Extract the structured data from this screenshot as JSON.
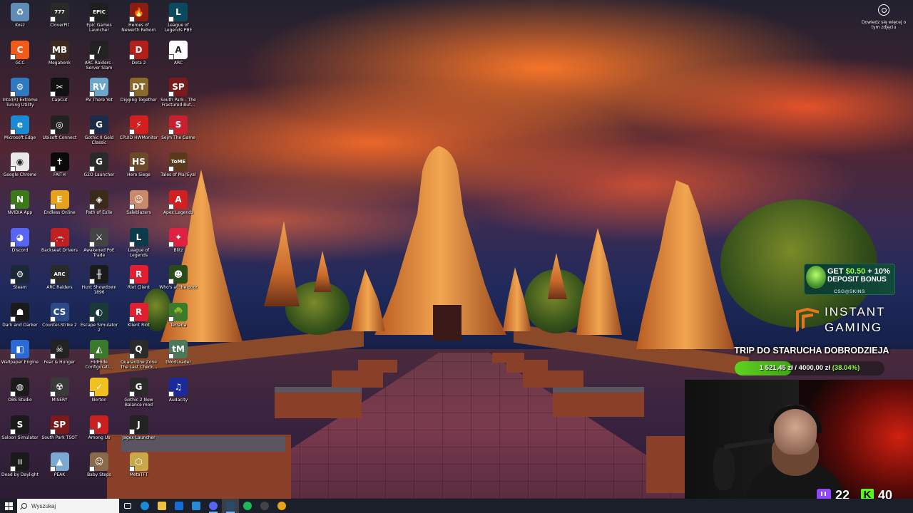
{
  "desktop": {
    "icons": [
      {
        "label": "Kosz",
        "icon": "recycle-bin-icon",
        "color": "#5f8db5",
        "glyph": "♻"
      },
      {
        "label": "CloverPit",
        "icon": "cloverpit-icon",
        "color": "#2a2a2a",
        "glyph": "777"
      },
      {
        "label": "Epic Games Launcher",
        "icon": "epic-games-icon",
        "color": "#1f1f1f",
        "glyph": "EPIC"
      },
      {
        "label": "Heroes of Newerth Reborn",
        "icon": "hon-icon",
        "color": "#8a1d12",
        "glyph": "🔥"
      },
      {
        "label": "League of Legends PBE",
        "icon": "lol-pbe-icon",
        "color": "#0b4a5c",
        "glyph": "L"
      },
      {
        "label": "GCC",
        "icon": "gcc-icon",
        "color": "#f05a1a",
        "glyph": "C"
      },
      {
        "label": "Megabonk",
        "icon": "megabonk-icon",
        "color": "#3d2b20",
        "glyph": "MB"
      },
      {
        "label": "ARC Raiders - Server Slam",
        "icon": "arc-raiders-icon",
        "color": "#222",
        "glyph": "/"
      },
      {
        "label": "Dota 2",
        "icon": "dota2-icon",
        "color": "#b3201a",
        "glyph": "D"
      },
      {
        "label": "ARC",
        "icon": "arc-icon",
        "color": "#ffffff",
        "glyph": "A"
      },
      {
        "label": "Intel(R) Extreme Tuning Utility",
        "icon": "intel-xtu-icon",
        "color": "#2f78c2",
        "glyph": "⚙"
      },
      {
        "label": "CapCut",
        "icon": "capcut-icon",
        "color": "#111",
        "glyph": "✂"
      },
      {
        "label": "RV There Yet",
        "icon": "rv-there-yet-icon",
        "color": "#6ca6c9",
        "glyph": "RV"
      },
      {
        "label": "Digging Together",
        "icon": "digging-together-icon",
        "color": "#8a6a2a",
        "glyph": "DT"
      },
      {
        "label": "South Park - The Fractured But...",
        "icon": "south-park-icon",
        "color": "#7a1a1a",
        "glyph": "SP"
      },
      {
        "label": "Microsoft Edge",
        "icon": "edge-icon",
        "color": "#1a8ad4",
        "glyph": "e"
      },
      {
        "label": "Ubisoft Connect",
        "icon": "ubisoft-icon",
        "color": "#222",
        "glyph": "◎"
      },
      {
        "label": "Gothic II Gold Classic",
        "icon": "gothic2-icon",
        "color": "#1c2b47",
        "glyph": "G"
      },
      {
        "label": "CPUID HWMonitor",
        "icon": "hwmonitor-icon",
        "color": "#d21f1f",
        "glyph": "⚡"
      },
      {
        "label": "Sejm The Game",
        "icon": "sejm-icon",
        "color": "#c82030",
        "glyph": "S"
      },
      {
        "label": "Google Chrome",
        "icon": "chrome-icon",
        "color": "#e8e8e8",
        "glyph": "◉"
      },
      {
        "label": "FAITH",
        "icon": "faith-icon",
        "color": "#0a0a0a",
        "glyph": "✝"
      },
      {
        "label": "G2O Launcher",
        "icon": "g2o-icon",
        "color": "#2a2a2a",
        "glyph": "G"
      },
      {
        "label": "Hero Siege",
        "icon": "hero-siege-icon",
        "color": "#6a4a2a",
        "glyph": "HS"
      },
      {
        "label": "Tales of Maj'Eyal",
        "icon": "tome-icon",
        "color": "#5a3a1a",
        "glyph": "ToME"
      },
      {
        "label": "NVIDIA App",
        "icon": "nvidia-icon",
        "color": "#3a7a1a",
        "glyph": "N"
      },
      {
        "label": "Endless Online",
        "icon": "endless-online-icon",
        "color": "#e8a21a",
        "glyph": "E"
      },
      {
        "label": "Path of Exile",
        "icon": "poe-icon",
        "color": "#3a2a1a",
        "glyph": "◈"
      },
      {
        "label": "Saleblazers",
        "icon": "saleblazers-icon",
        "color": "#c88a6a",
        "glyph": "☺"
      },
      {
        "label": "Apex Legends",
        "icon": "apex-icon",
        "color": "#d21f1f",
        "glyph": "A"
      },
      {
        "label": "Discord",
        "icon": "discord-icon",
        "color": "#5865f2",
        "glyph": "◕"
      },
      {
        "label": "Backseat Drivers",
        "icon": "backseat-drivers-icon",
        "color": "#c02020",
        "glyph": "🚗"
      },
      {
        "label": "Awakened PoE Trade",
        "icon": "awakened-poe-icon",
        "color": "#444",
        "glyph": "⚔"
      },
      {
        "label": "League of Legends",
        "icon": "lol-icon",
        "color": "#0b3a4a",
        "glyph": "L"
      },
      {
        "label": "Blitz",
        "icon": "blitz-icon",
        "color": "#e02040",
        "glyph": "✦"
      },
      {
        "label": "Steam",
        "icon": "steam-icon",
        "color": "#1b2838",
        "glyph": "⚙"
      },
      {
        "label": "ARC Raiders",
        "icon": "arc-raiders-2-icon",
        "color": "#2a2a2a",
        "glyph": "ARC"
      },
      {
        "label": "Hunt Showdown 1896",
        "icon": "hunt-showdown-icon",
        "color": "#1a1a1a",
        "glyph": "╫"
      },
      {
        "label": "Riot Client",
        "icon": "riot-client-icon",
        "color": "#e02030",
        "glyph": "R"
      },
      {
        "label": "Who's at the door",
        "icon": "whos-at-the-door-icon",
        "color": "#2a4a1a",
        "glyph": "☻"
      },
      {
        "label": "Dark and Darker",
        "icon": "dark-and-darker-icon",
        "color": "#1a1a1a",
        "glyph": "☗"
      },
      {
        "label": "Counter-Strike 2",
        "icon": "cs2-icon",
        "color": "#2a4a8a",
        "glyph": "CS"
      },
      {
        "label": "Escape Simulator 2",
        "icon": "escape-sim-icon",
        "color": "#1a3a3a",
        "glyph": "◐"
      },
      {
        "label": "Klient Riot",
        "icon": "klient-riot-icon",
        "color": "#e02030",
        "glyph": "R"
      },
      {
        "label": "Terraria",
        "icon": "terraria-icon",
        "color": "#3a7a2a",
        "glyph": "🌳"
      },
      {
        "label": "Wallpaper Engine",
        "icon": "wallpaper-engine-icon",
        "color": "#2a6ad4",
        "glyph": "◧"
      },
      {
        "label": "Fear & Hunger",
        "icon": "fear-hunger-icon",
        "color": "#222",
        "glyph": "☠"
      },
      {
        "label": "HidHide Configurati...",
        "icon": "hidhide-icon",
        "color": "#3a7a2a",
        "glyph": "◭"
      },
      {
        "label": "Quarantine Zone The Last Check...",
        "icon": "quarantine-zone-icon",
        "color": "#2a2a2a",
        "glyph": "Q"
      },
      {
        "label": "tModLoader",
        "icon": "tmodloader-icon",
        "color": "#4a7a5a",
        "glyph": "tM"
      },
      {
        "label": "OBS Studio",
        "icon": "obs-icon",
        "color": "#1a1a1a",
        "glyph": "◍"
      },
      {
        "label": "MISERY",
        "icon": "misery-icon",
        "color": "#3a3a3a",
        "glyph": "☢"
      },
      {
        "label": "Norton",
        "icon": "norton-icon",
        "color": "#f0c020",
        "glyph": "✓"
      },
      {
        "label": "Gothic 2 New Balance mod",
        "icon": "gothic2-nb-icon",
        "color": "#2a2a2a",
        "glyph": "G"
      },
      {
        "label": "Audacity",
        "icon": "audacity-icon",
        "color": "#1a2a9a",
        "glyph": "♫"
      },
      {
        "label": "Saloon Simulator",
        "icon": "saloon-sim-icon",
        "color": "#1a1a1a",
        "glyph": "S"
      },
      {
        "label": "South Park TSOT",
        "icon": "south-park-tsot-icon",
        "color": "#7a1a1a",
        "glyph": "SP"
      },
      {
        "label": "Among Us",
        "icon": "among-us-icon",
        "color": "#c81f1f",
        "glyph": "◗"
      },
      {
        "label": "Jagex Launcher",
        "icon": "jagex-icon",
        "color": "#222",
        "glyph": "J"
      },
      {
        "label": "Dead by Daylight",
        "icon": "dbd-icon",
        "color": "#1a1a1a",
        "glyph": "|||"
      },
      {
        "label": "PEAK",
        "icon": "peak-icon",
        "color": "#7aaad4",
        "glyph": "▲"
      },
      {
        "label": "Baby Steps",
        "icon": "baby-steps-icon",
        "color": "#8a6a4a",
        "glyph": "☺"
      },
      {
        "label": "MetaTFT",
        "icon": "metatft-icon",
        "color": "#c8a84a",
        "glyph": "⬡"
      }
    ]
  },
  "wallpaper": {
    "learn_more": "Dowiedz się więcej o tym zdjęciu"
  },
  "overlays": {
    "csgo_promo": {
      "line1_prefix": "GET ",
      "line1_amount": "$0.50",
      "line1_suffix": " + 10%",
      "line2": "DEPOSIT BONUS",
      "brand": "CSG◎SKINS"
    },
    "instant_gaming": {
      "word1": "INSTANT",
      "word2": "GAMING"
    },
    "goal": {
      "title": "TRIP DO STARUCHA DOBRODZIEJA",
      "current": "1 521,45 zł",
      "target": "4000,00 zł",
      "percent_text": "(38.04%)",
      "fraction": 0.3804
    },
    "viewers": {
      "twitch": "22",
      "kick_letter": "K",
      "kick": "40"
    }
  },
  "taskbar": {
    "search_placeholder": "Wyszukaj",
    "apps": [
      {
        "name": "task-view-icon",
        "color": "#ffffff"
      },
      {
        "name": "edge-icon",
        "color": "#1a8ad4"
      },
      {
        "name": "file-explorer-icon",
        "color": "#f0c040"
      },
      {
        "name": "outlook-icon",
        "color": "#1a6ad4"
      },
      {
        "name": "store-icon",
        "color": "#2a8ad4"
      },
      {
        "name": "discord-icon",
        "color": "#5865f2"
      },
      {
        "name": "steam-icon",
        "color": "#2a4a6a"
      },
      {
        "name": "spotify-icon",
        "color": "#1db954"
      },
      {
        "name": "obs-icon",
        "color": "#444444"
      },
      {
        "name": "chrome-icon",
        "color": "#e8a21a"
      }
    ]
  }
}
